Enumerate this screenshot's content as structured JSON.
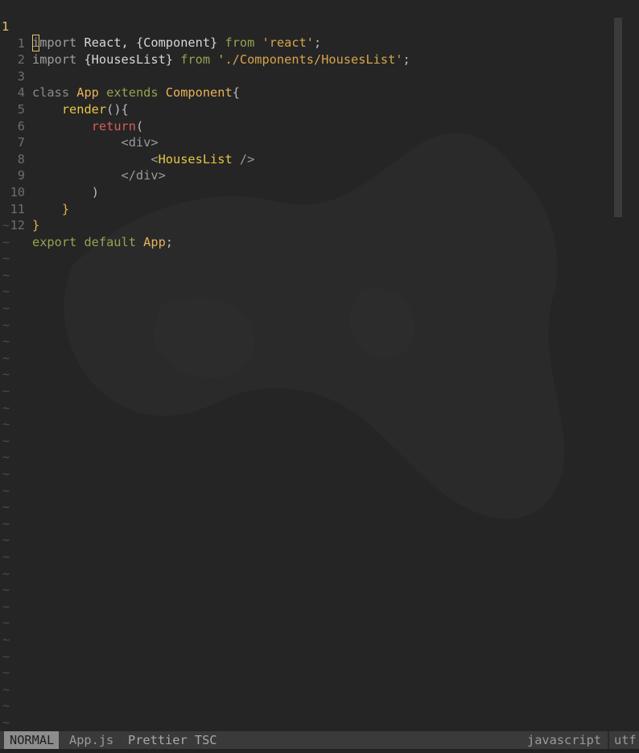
{
  "editor": {
    "current_line": {
      "number": "1",
      "cursor_char": "i",
      "rest": "mport",
      "ident": " React, {Component} ",
      "from": "from",
      "str": " 'react'",
      "end": ";"
    },
    "lines": [
      {
        "num": "1"
      },
      {
        "num": "2"
      },
      {
        "num": "3"
      },
      {
        "num": "4"
      },
      {
        "num": "5"
      },
      {
        "num": "6"
      },
      {
        "num": "7"
      },
      {
        "num": "8"
      },
      {
        "num": "9"
      },
      {
        "num": "10"
      },
      {
        "num": "11"
      },
      {
        "num": "12"
      }
    ],
    "code": {
      "l1_import": "import",
      "l1_ident": " {HousesList} ",
      "l1_from": "from",
      "l1_str": " './Components/HousesList'",
      "l1_end": ";",
      "l3_class": "class ",
      "l3_name": "App",
      "l3_extends": " extends ",
      "l3_super": "Component",
      "l3_brace": "{",
      "l4_indent": "    ",
      "l4_render": "render",
      "l4_rest": "(){",
      "l5_indent": "        ",
      "l5_return": "return",
      "l5_paren": "(",
      "l6_indent": "            ",
      "l6_tag": "<div>",
      "l7_indent": "                ",
      "l7_open": "<",
      "l7_comp": "HousesList",
      "l7_close": " />",
      "l8_indent": "            ",
      "l8_tag": "</div>",
      "l9_indent": "        ",
      "l9_paren": ")",
      "l10_indent": "    ",
      "l10_brace": "}",
      "l11_brace": "}",
      "l12_export": "export default ",
      "l12_name": "App",
      "l12_end": ";"
    },
    "tilde": "~"
  },
  "statusbar": {
    "mode": "NORMAL",
    "file": "App.js",
    "plugins": "Prettier TSC",
    "filetype": "javascript",
    "encoding": "utf"
  },
  "colors": {
    "background": "#252525",
    "statusbar": "#3a3a3a",
    "mode_bg": "#8d8d8d",
    "cursor": "#e2c16f"
  }
}
